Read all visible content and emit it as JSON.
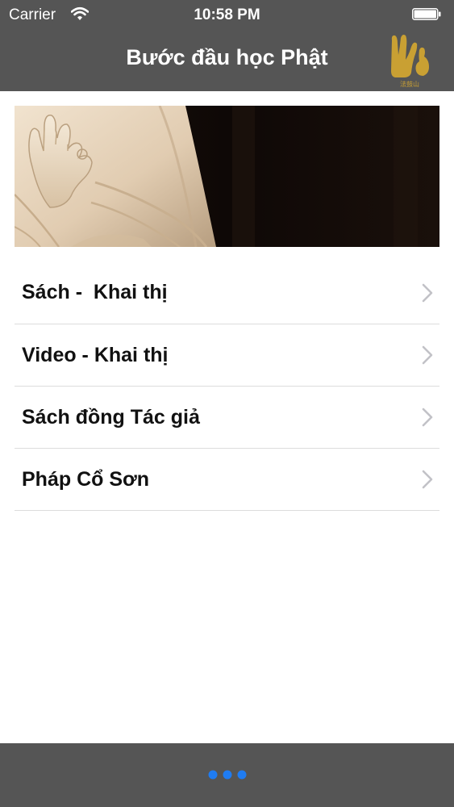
{
  "status_bar": {
    "carrier": "Carrier",
    "time": "10:58 PM"
  },
  "nav": {
    "title": "Bước đầu học Phật",
    "logo_caption": "法鼓山"
  },
  "menu": {
    "items": [
      {
        "label": "Sách -  Khai thị"
      },
      {
        "label": "Video - Khai thị"
      },
      {
        "label": "Sách đồng Tác giả"
      },
      {
        "label": "Pháp Cổ Sơn"
      }
    ]
  },
  "tab_bar": {
    "icon": "more-dots-icon"
  },
  "colors": {
    "bars": "#555555",
    "logo_gold": "#c9a033",
    "dots_accent": "#1f7cf2",
    "separator": "#dcdcdc",
    "chevron": "#c2c2c7"
  }
}
